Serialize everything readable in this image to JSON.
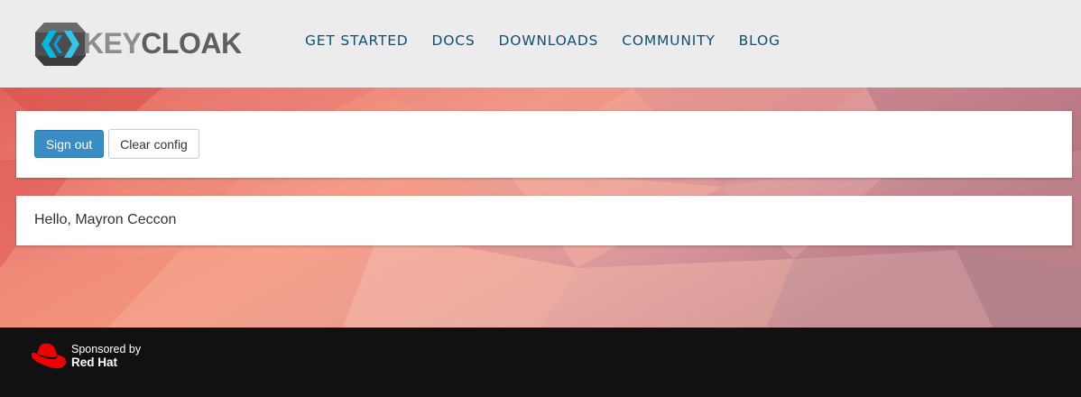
{
  "header": {
    "logo_text_key": "KEY",
    "logo_text_cloak": "CLOAK",
    "nav": [
      {
        "label": "GET STARTED"
      },
      {
        "label": "DOCS"
      },
      {
        "label": "DOWNLOADS"
      },
      {
        "label": "COMMUNITY"
      },
      {
        "label": "BLOG"
      }
    ]
  },
  "actions": {
    "sign_out_label": "Sign out",
    "clear_config_label": "Clear config"
  },
  "greeting": "Hello, Mayron Ceccon",
  "footer": {
    "sponsored_by": "Sponsored by",
    "sponsor_name": "Red Hat"
  },
  "colors": {
    "header_bg": "#ececec",
    "nav_link": "#0e4f78",
    "primary_button": "#3a8cc4",
    "footer_bg": "#111111",
    "redhat_red": "#ee0000"
  },
  "icons": {
    "logo": "keycloak-logo-icon",
    "sponsor": "redhat-hat-icon"
  }
}
